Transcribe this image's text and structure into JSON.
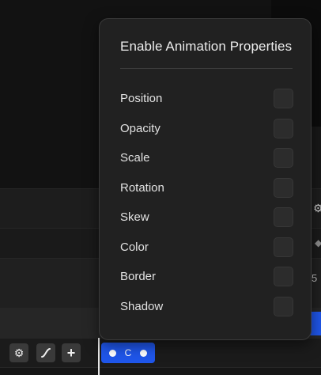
{
  "popover": {
    "title": "Enable Animation Properties",
    "properties": [
      {
        "label": "Position",
        "enabled": false
      },
      {
        "label": "Opacity",
        "enabled": false
      },
      {
        "label": "Scale",
        "enabled": false
      },
      {
        "label": "Rotation",
        "enabled": false
      },
      {
        "label": "Skew",
        "enabled": false
      },
      {
        "label": "Color",
        "enabled": false
      },
      {
        "label": "Border",
        "enabled": false
      },
      {
        "label": "Shadow",
        "enabled": false
      }
    ]
  },
  "timeline": {
    "tools": [
      {
        "name": "settings",
        "icon": "gear-icon",
        "glyph": "⚙"
      },
      {
        "name": "curve",
        "icon": "easing-curve-icon",
        "glyph": ""
      },
      {
        "name": "add",
        "icon": "plus-icon",
        "glyph": "+"
      }
    ],
    "keyframe_glyph": "C",
    "edge_value": "5"
  },
  "colors": {
    "accent": "#1f56ea",
    "panel_bg": "#212121",
    "app_bg": "#141414"
  }
}
